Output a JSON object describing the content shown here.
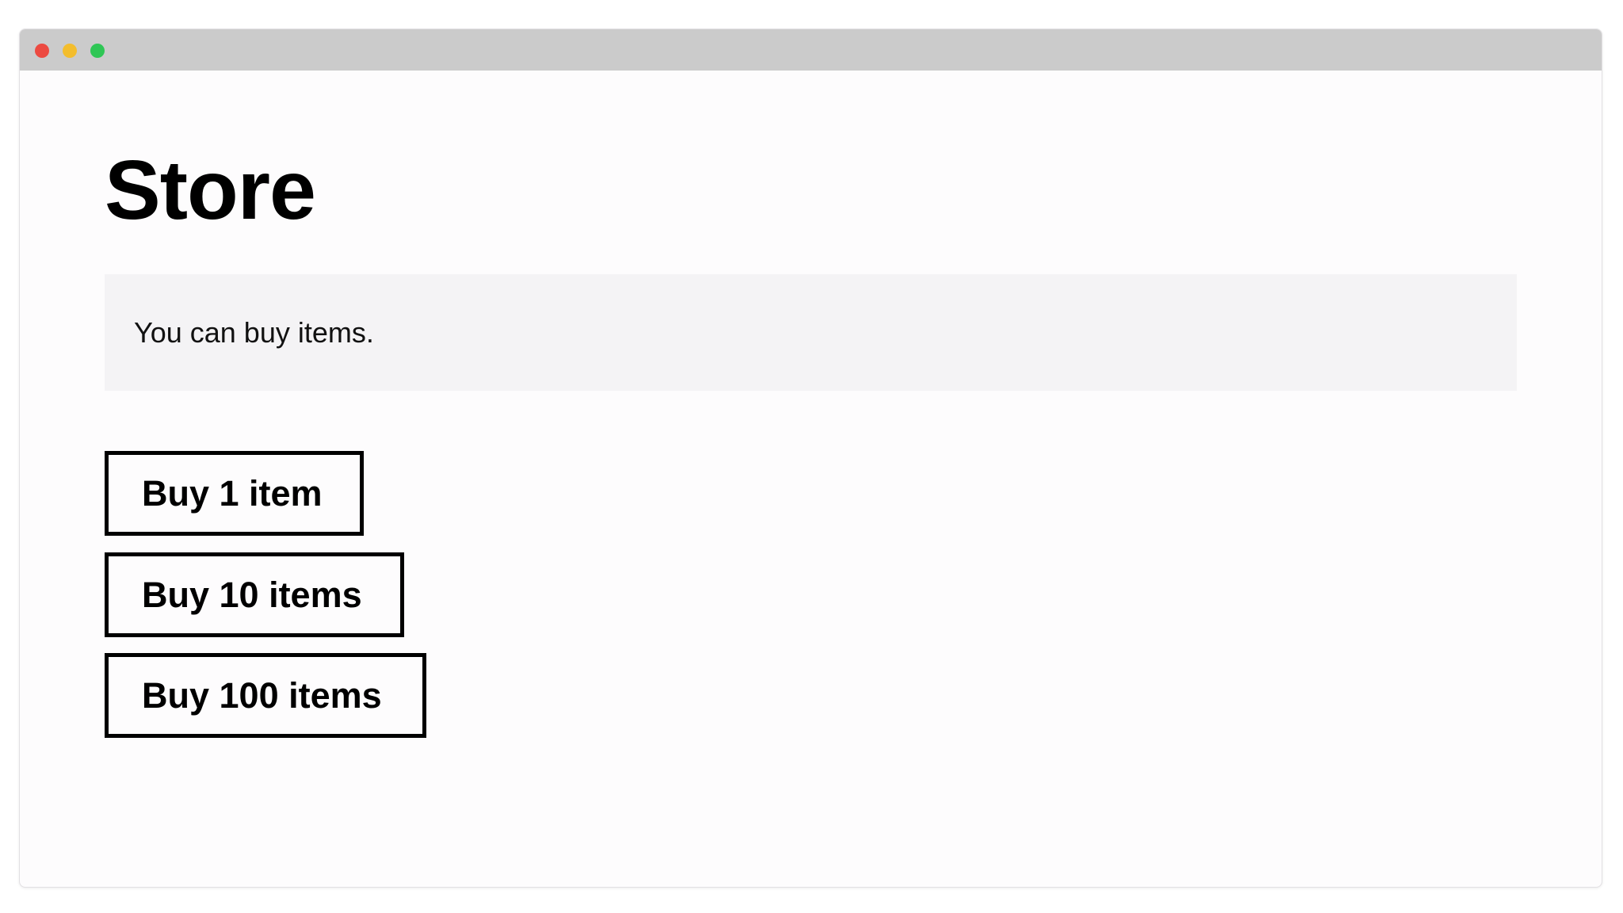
{
  "window": {
    "controls": [
      {
        "name": "close",
        "color": "#ec4a41"
      },
      {
        "name": "minimize",
        "color": "#f3bd2d"
      },
      {
        "name": "zoom",
        "color": "#2fc655"
      }
    ]
  },
  "page": {
    "title": "Store",
    "notice": "You can buy items."
  },
  "buttons": [
    {
      "label": "Buy 1 item"
    },
    {
      "label": "Buy 10 items"
    },
    {
      "label": "Buy 100 items"
    }
  ]
}
